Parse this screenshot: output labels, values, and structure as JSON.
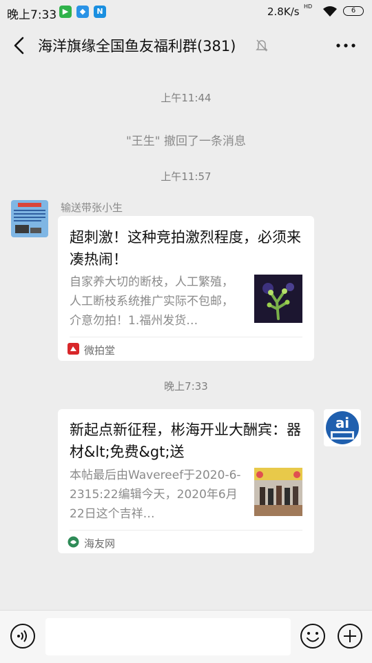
{
  "status_bar": {
    "time": "晚上7:33",
    "net_speed": "2.8K/s",
    "hd_label": "HD",
    "battery": "6"
  },
  "header": {
    "title": "海洋旗缘全国鱼友福利群(381)"
  },
  "messages": {
    "time1": "上午11:44",
    "recall_notice": "\"王生\" 撤回了一条消息",
    "time2": "上午11:57",
    "sender1": "输送带张小生",
    "card1": {
      "title": "超刺激！这种竞拍激烈程度，必须来凑热闹！",
      "description": "自家养大切的断枝，人工繁殖，人工断枝系统推广实际不包邮，介意勿拍！1.福州发货…",
      "source": "微拍堂",
      "source_color": "#d8272a"
    },
    "time3": "晚上7:33",
    "card2": {
      "title": "新起点新征程，彬海开业大酬宾：器材&lt;免费&gt;送",
      "description": "本帖最后由Wavereef于2020-6-2315:22编辑今天，2020年6月22日这个吉祥…",
      "source": "海友网",
      "source_color": "#2e8b57"
    }
  },
  "colors": {
    "background": "#ededed",
    "card": "#ffffff",
    "input_bar": "#f6f6f6"
  }
}
